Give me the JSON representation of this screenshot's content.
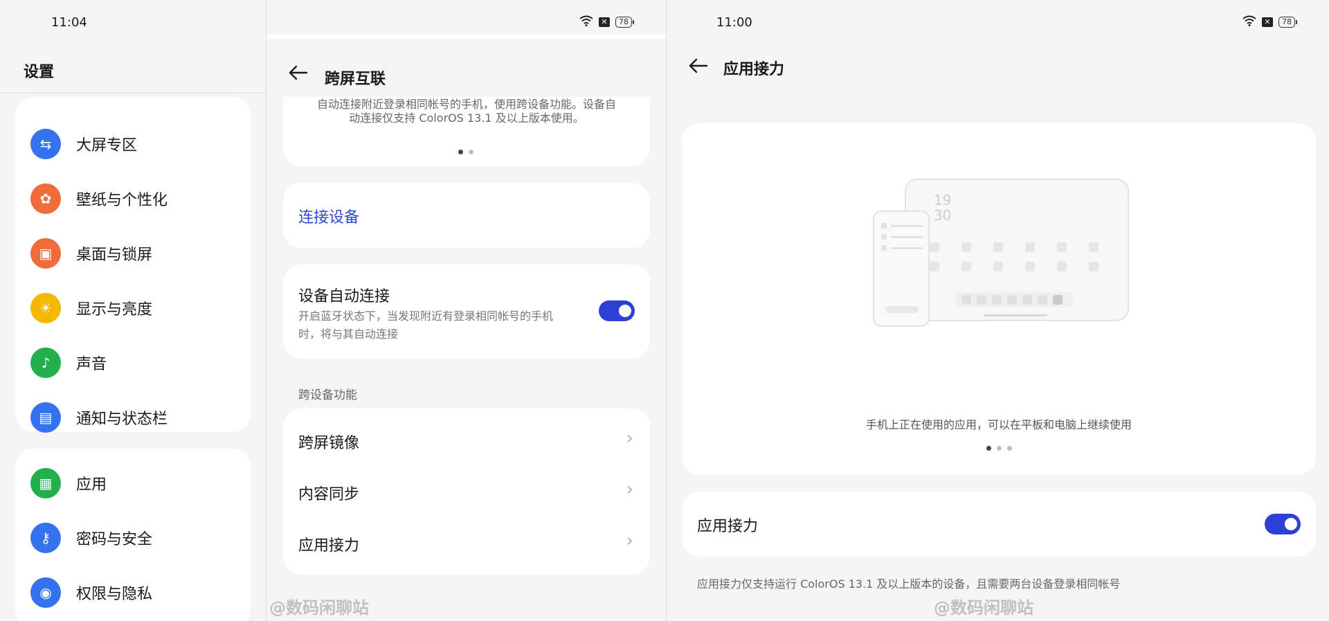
{
  "left": {
    "time": "11:04",
    "title": "设置",
    "group1": [
      {
        "label": "大屏专区",
        "icon": "split-screen-icon",
        "color": "#3572f0"
      },
      {
        "label": "壁纸与个性化",
        "icon": "palette-icon",
        "color": "#f06b3a"
      },
      {
        "label": "桌面与锁屏",
        "icon": "image-icon",
        "color": "#f06b3a"
      },
      {
        "label": "显示与亮度",
        "icon": "sun-icon",
        "color": "#f5b800"
      },
      {
        "label": "声音",
        "icon": "bell-icon",
        "color": "#22b04d"
      },
      {
        "label": "通知与状态栏",
        "icon": "notification-icon",
        "color": "#3572f0"
      }
    ],
    "group2": [
      {
        "label": "应用",
        "icon": "apps-grid-icon",
        "color": "#22b04d"
      },
      {
        "label": "密码与安全",
        "icon": "key-icon",
        "color": "#3572f0"
      },
      {
        "label": "权限与隐私",
        "icon": "privacy-eye-icon",
        "color": "#3572f0"
      }
    ]
  },
  "mid": {
    "battery": "78",
    "title": "跨屏互联",
    "intro_line1": "自动连接附近登录相同帐号的手机，使用跨设备功能。设备自",
    "intro_line2": "动连接仅支持 ColorOS 13.1 及以上版本使用。",
    "connect_device": "连接设备",
    "auto_connect_title": "设备自动连接",
    "auto_connect_desc1": "开启蓝牙状态下，当发现附近有登录相同帐号的手机",
    "auto_connect_desc2": "时，将与其自动连接",
    "auto_connect_on": true,
    "section_label": "跨设备功能",
    "features": [
      "跨屏镜像",
      "内容同步",
      "应用接力"
    ],
    "watermark": "@数码闲聊站"
  },
  "right": {
    "time": "11:00",
    "battery": "78",
    "title": "应用接力",
    "illus_clock_h": "19",
    "illus_clock_m": "30",
    "caption": "手机上正在使用的应用，可以在平板和电脑上继续使用",
    "toggle_label": "应用接力",
    "toggle_on": true,
    "footnote": "应用接力仅支持运行 ColorOS 13.1 及以上版本的设备，且需要两台设备登录相同帐号",
    "watermark": "@数码闲聊站"
  },
  "colors": {
    "accent": "#2e3fd6",
    "link": "#2e4bd0"
  }
}
